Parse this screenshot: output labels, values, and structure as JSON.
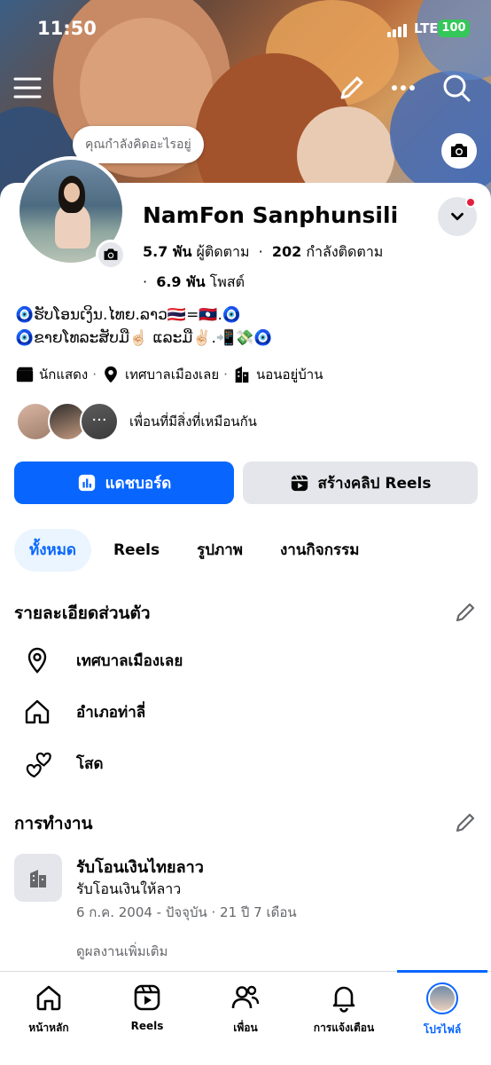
{
  "status_bar": {
    "time": "11:50",
    "network": "LTE",
    "battery": "100"
  },
  "profile": {
    "name": "NamFon Sanphunsili",
    "followers_count": "5.7 พัน",
    "followers_label": "ผู้ติดตาม",
    "following_count": "202",
    "following_label": "กำลังติดตาม",
    "posts_count": "6.9 พัน",
    "posts_label": "โพสต์",
    "status_bubble": "คุณกำลังคิดอะไรอยู่",
    "bio_line1": "🧿ຮັບໂອນເງິນ.ໄທຍ.ລາວ🇹🇭=🇱🇦.🧿",
    "bio_line2": "🧿ຂາຍໂທລະສັບມື☝🏻 ແລະມື✌🏻.📲💸🧿"
  },
  "info_row": [
    {
      "icon": "clapperboard-icon",
      "label": "นักแสดง"
    },
    {
      "icon": "location-pin-icon",
      "label": "เทศบาลเมืองเลย"
    },
    {
      "icon": "building-icon",
      "label": "นอนอยู่บ้าน"
    }
  ],
  "mutual": {
    "text": "เพื่อนที่มีสิ่งที่เหมือนกัน",
    "more_glyph": "···"
  },
  "actions": {
    "dashboard_label": "แดชบอร์ด",
    "create_reels_label": "สร้างคลิป Reels"
  },
  "tabs": [
    {
      "label": "ทั้งหมด",
      "active": true
    },
    {
      "label": "Reels",
      "active": false
    },
    {
      "label": "รูปภาพ",
      "active": false
    },
    {
      "label": "งานกิจกรรม",
      "active": false
    }
  ],
  "personal_details": {
    "title": "รายละเอียดส่วนตัว",
    "items": [
      {
        "icon": "location-pin-icon",
        "label": "เทศบาลเมืองเลย"
      },
      {
        "icon": "home-icon",
        "label": "อำเภอท่าลี่"
      },
      {
        "icon": "hearts-icon",
        "label": "โสด"
      }
    ]
  },
  "work": {
    "title": "การทำงาน",
    "company": "รับโอนเงินไทยลาว",
    "position": "รับโอนเงินให้ลาว",
    "dates": "6 ก.ค. 2004 - ปัจจุบัน · 21 ปี 7 เดือน",
    "see_more": "ดูผลงานเพิ่มเติม"
  },
  "bottom_nav": [
    {
      "icon": "home-icon",
      "label": "หน้าหลัก"
    },
    {
      "icon": "reels-icon",
      "label": "Reels"
    },
    {
      "icon": "friends-icon",
      "label": "เพื่อน"
    },
    {
      "icon": "bell-icon",
      "label": "การแจ้งเตือน"
    },
    {
      "icon": "profile-avatar",
      "label": "โปรไฟล์",
      "active": true
    }
  ],
  "colors": {
    "accent": "#0866ff",
    "secondary_button": "#e4e6eb",
    "active_tab_bg": "#ebf5ff",
    "notification_dot": "#e41e3f",
    "battery": "#34c759",
    "text_primary": "#050505",
    "text_secondary": "#65676b"
  }
}
